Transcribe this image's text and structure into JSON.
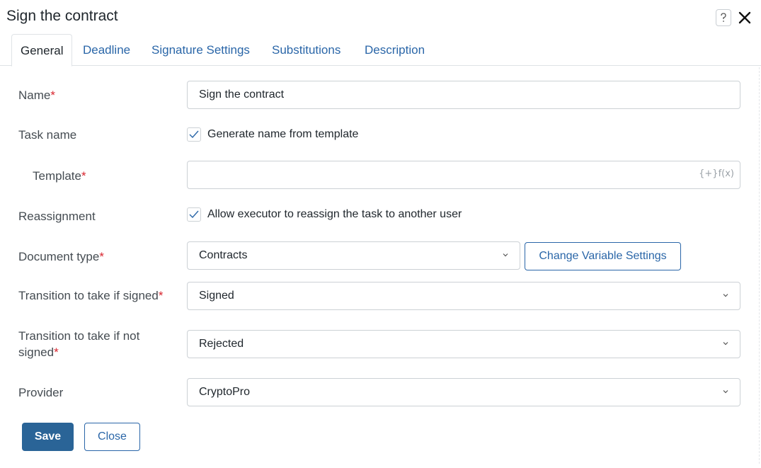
{
  "window": {
    "title": "Sign the contract",
    "help_icon": "question-icon",
    "close_icon": "close-icon"
  },
  "tabs": [
    {
      "label": "General",
      "active": true
    },
    {
      "label": "Deadline",
      "active": false
    },
    {
      "label": "Signature Settings",
      "active": false
    },
    {
      "label": "Substitutions",
      "active": false
    },
    {
      "label": "Description",
      "active": false
    }
  ],
  "form": {
    "name": {
      "label": "Name",
      "required_mark": "*",
      "value": "Sign the contract"
    },
    "task_name": {
      "label": "Task name",
      "checkbox_label": "Generate name from template",
      "checked": true
    },
    "template": {
      "label": "Template",
      "required_mark": "*",
      "value": "",
      "fx_label": "{+}f(x)"
    },
    "reassignment": {
      "label": "Reassignment",
      "checkbox_label": "Allow executor to reassign the task to another user",
      "checked": true
    },
    "document_type": {
      "label": "Document type",
      "required_mark": "*",
      "value": "Contracts",
      "settings_button": "Change Variable Settings"
    },
    "transition_signed": {
      "label": "Transition to take if signed",
      "required_mark": "*",
      "value": "Signed"
    },
    "transition_not_signed": {
      "label_line1": "Transition to take if not",
      "label_line2": "signed",
      "required_mark": "*",
      "value": "Rejected"
    },
    "provider": {
      "label": "Provider",
      "value": "CryptoPro"
    }
  },
  "footer": {
    "save_label": "Save",
    "close_label": "Close"
  },
  "colors": {
    "accent": "#2a66a8",
    "primary_button": "#2a6497",
    "required": "#d8262f",
    "border": "#ccd1d5"
  }
}
